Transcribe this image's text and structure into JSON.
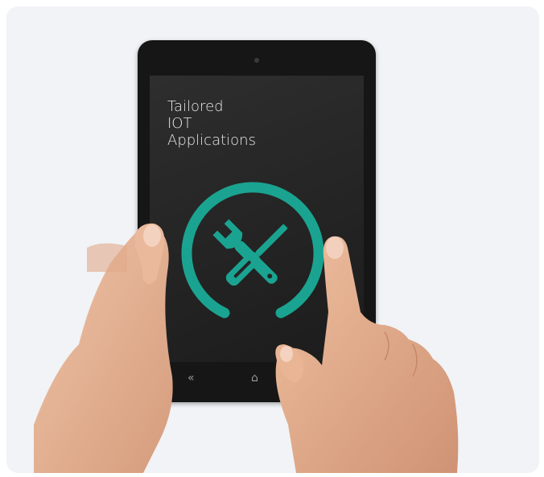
{
  "screen": {
    "title_lines": [
      "Tailored",
      "IOT",
      "Applications"
    ]
  },
  "colors": {
    "accent": "#1aa390",
    "background": "#f1f3f6",
    "skin": "#e6b497"
  },
  "icons": {
    "main": "wrench-screwdriver-icon",
    "nav": [
      "back-icon",
      "home-icon",
      "recent-apps-icon"
    ]
  }
}
